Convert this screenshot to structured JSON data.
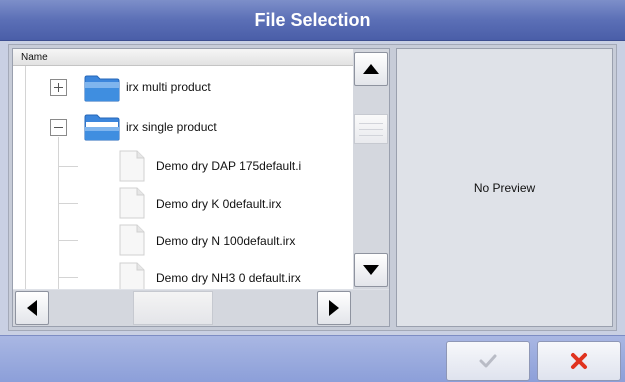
{
  "window": {
    "title": "File Selection"
  },
  "tree": {
    "header": "Name",
    "items": [
      {
        "label": "irx multi product",
        "type": "folder",
        "expanded": false
      },
      {
        "label": "irx single product",
        "type": "folder",
        "expanded": true
      },
      {
        "label": "Demo dry DAP 175default.i",
        "type": "file"
      },
      {
        "label": "Demo dry K 0default.irx",
        "type": "file"
      },
      {
        "label": "Demo dry N 100default.irx",
        "type": "file"
      },
      {
        "label": "Demo dry NH3 0 default.irx",
        "type": "file"
      }
    ]
  },
  "preview": {
    "text": "No Preview"
  },
  "icons": {
    "expand": "plus-box-icon",
    "collapse": "minus-box-icon",
    "folder": "folder-icon",
    "file": "document-icon",
    "scroll_up": "triangle-up-icon",
    "scroll_down": "triangle-down-icon",
    "scroll_left": "triangle-left-icon",
    "scroll_right": "triangle-right-icon",
    "accept": "checkmark-icon",
    "cancel": "x-icon"
  },
  "colors": {
    "title_bar": "#5b6fb6",
    "bottom_bar": "#8c9fd9",
    "accept_disabled": "#b9bcc6",
    "cancel": "#e0331f",
    "folder_blue": "#2f7fd8"
  }
}
